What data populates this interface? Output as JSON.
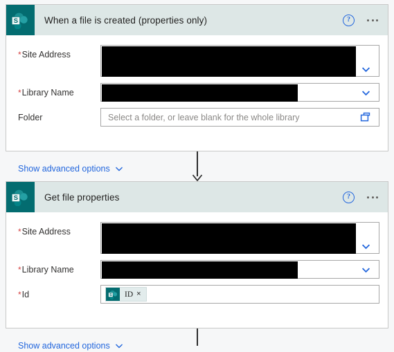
{
  "page": {
    "background_color": "#f6f7f8",
    "accent_blue": "#2266dd",
    "sharepoint_teal": "#036c70",
    "header_band_color": "#dde7e6",
    "required_marker": "*",
    "required_marker_color": "#d43f3f"
  },
  "cards": [
    {
      "id": "when-a-file-is-created",
      "title": "When a file is created (properties only)",
      "icon": "sharepoint-icon",
      "help_icon": "help-icon",
      "overflow_icon": "ellipsis-icon",
      "fields": [
        {
          "label": "Site Address",
          "required": true,
          "type": "dropdown",
          "value": "",
          "redacted": true,
          "dropdown_icon": "chevron-down-icon"
        },
        {
          "label": "Library Name",
          "required": true,
          "type": "dropdown",
          "value": "",
          "redacted": true,
          "dropdown_icon": "chevron-down-icon"
        },
        {
          "label": "Folder",
          "required": false,
          "type": "picker",
          "value": "",
          "placeholder": "Select a folder, or leave blank for the whole library",
          "picker_icon": "folder-icon"
        }
      ],
      "advanced_options_label": "Show advanced options",
      "advanced_options_icon": "chevron-down-icon"
    },
    {
      "id": "get-file-properties",
      "title": "Get file properties",
      "icon": "sharepoint-icon",
      "help_icon": "help-icon",
      "overflow_icon": "ellipsis-icon",
      "fields": [
        {
          "label": "Site Address",
          "required": true,
          "type": "dropdown",
          "value": "",
          "redacted": true,
          "dropdown_icon": "chevron-down-icon"
        },
        {
          "label": "Library Name",
          "required": true,
          "type": "dropdown",
          "value": "",
          "redacted": true,
          "dropdown_icon": "chevron-down-icon"
        },
        {
          "label": "Id",
          "required": true,
          "type": "token",
          "token": {
            "icon": "sharepoint-icon",
            "text": "ID",
            "remove_icon": "close-icon",
            "remove_label": "×"
          }
        }
      ],
      "advanced_options_label": "Show advanced options",
      "advanced_options_icon": "chevron-down-icon"
    }
  ],
  "connectors": [
    {
      "name": "connector-trigger-to-action",
      "has_arrowhead": true
    },
    {
      "name": "connector-action-to-next",
      "has_arrowhead": false
    }
  ]
}
